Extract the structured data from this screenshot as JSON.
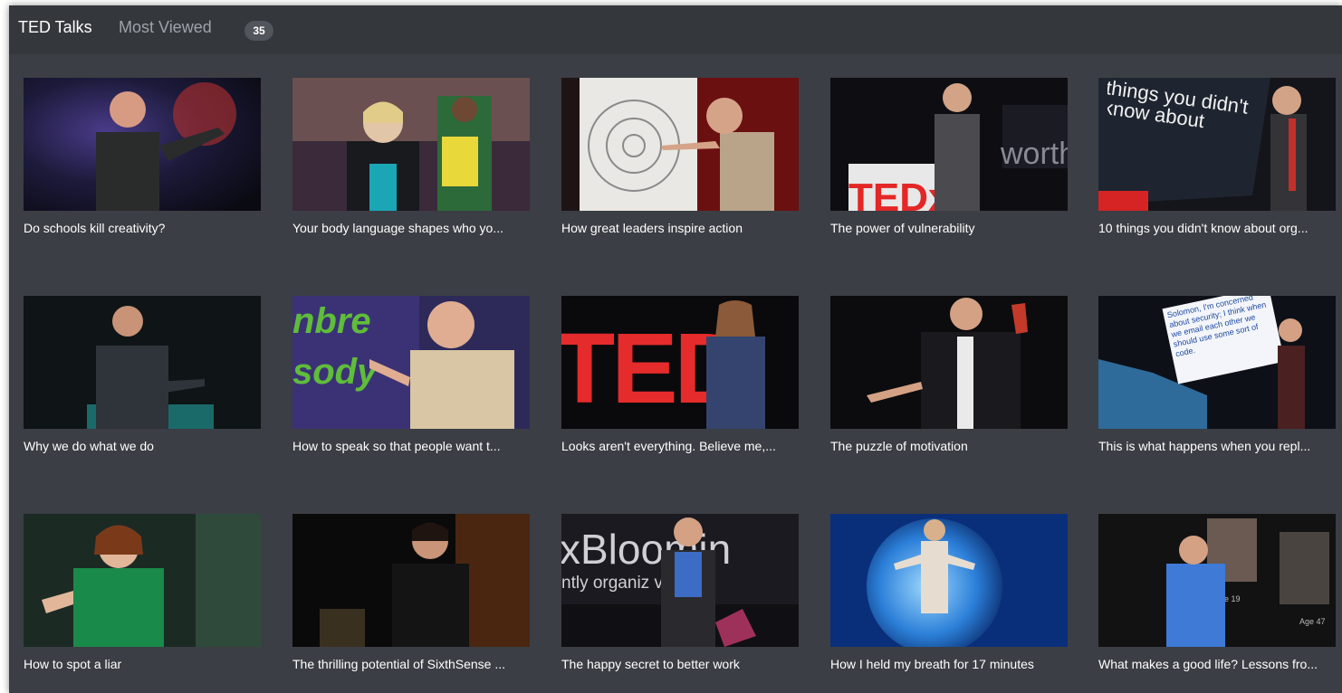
{
  "header": {
    "title": "TED Talks",
    "tab": "Most Viewed",
    "count": "35"
  },
  "talks": [
    {
      "title": "Do schools kill creativity?",
      "thumb_text": ""
    },
    {
      "title": "Your body language shapes who yo...",
      "thumb_text": ""
    },
    {
      "title": "How great leaders inspire action",
      "thumb_text": ""
    },
    {
      "title": "The power of vulnerability",
      "thumb_text": "TEDx",
      "thumb_text2": "worth"
    },
    {
      "title": "10 things you didn't know about org...",
      "thumb_text": "things you didn't know about"
    },
    {
      "title": "Why we do what we do",
      "thumb_text": ""
    },
    {
      "title": "How to speak so that people want t...",
      "thumb_text": "nbre sody"
    },
    {
      "title": "Looks aren't everything. Believe me,...",
      "thumb_text": "TED"
    },
    {
      "title": "The puzzle of motivation",
      "thumb_text": ""
    },
    {
      "title": "This is what happens when you repl...",
      "thumb_text": "Solomon, I'm concerned about security; I think when we email each other we should use some sort of code."
    },
    {
      "title": "How to spot a liar",
      "thumb_text": ""
    },
    {
      "title": "The thrilling potential of SixthSense ...",
      "thumb_text": ""
    },
    {
      "title": "The happy secret to better work",
      "thumb_text": "xBloomin",
      "thumb_text2": "ntly organiz    vent"
    },
    {
      "title": "How I held my breath for 17 minutes",
      "thumb_text": ""
    },
    {
      "title": "What makes a good life? Lessons fro...",
      "thumb_text": "Age 19",
      "thumb_text2": "Age 47"
    }
  ]
}
